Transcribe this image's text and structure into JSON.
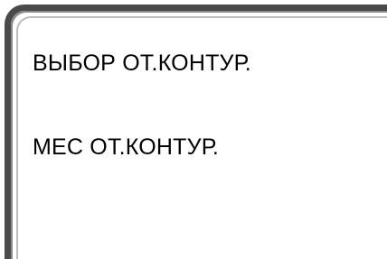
{
  "display": {
    "line_1": "ВЫБОР ОТ.КОНТУР.",
    "line_2": "МЕС ОТ.КОНТУР."
  },
  "colors": {
    "frame_border": "#4a4a4a",
    "text": "#000000",
    "background": "#ffffff"
  }
}
